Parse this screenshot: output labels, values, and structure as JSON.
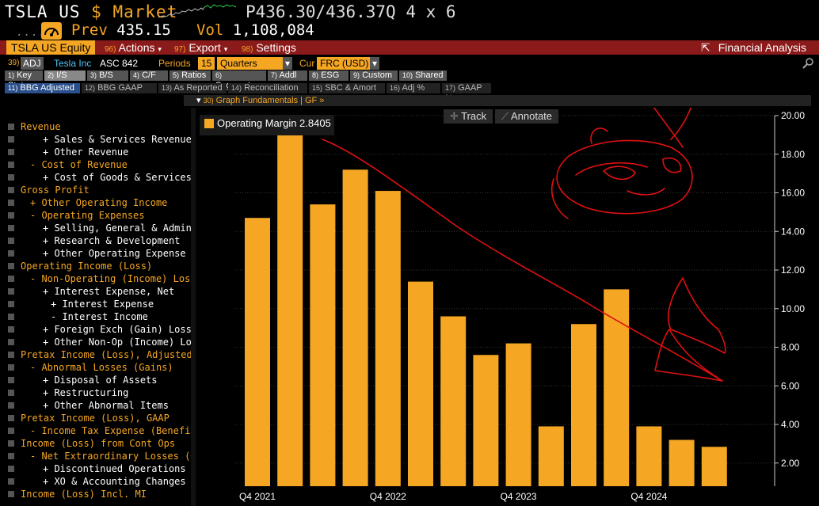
{
  "header": {
    "ticker": "TSLA US",
    "currency_symbol": "$",
    "market_label": "Market",
    "price_bid": "P436.30",
    "price_sep": "/",
    "price_ask": "436.37Q",
    "size": "4 x 6",
    "prev_label": "Prev",
    "prev_value": "435.15",
    "vol_label": "Vol",
    "vol_value": "1,108,084",
    "dots": "....."
  },
  "toolbar": {
    "security": "TSLA US Equity",
    "actions_num": "96)",
    "actions_label": "Actions",
    "export_num": "97)",
    "export_label": "Export",
    "settings_num": "98)",
    "settings_label": "Settings",
    "fa_label": "Financial Analysis"
  },
  "security_row": {
    "num": "39)",
    "adj": "ADJ",
    "company": "Tesla Inc",
    "standard": "ASC 842",
    "periods_label": "Periods",
    "periods_value": "15",
    "periods_type": "Quarters",
    "cur_label": "Cur",
    "cur_value": "FRC (USD)"
  },
  "tabs": [
    {
      "num": "1)",
      "label": "Key Stats"
    },
    {
      "num": "2)",
      "label": "I/S"
    },
    {
      "num": "3)",
      "label": "B/S"
    },
    {
      "num": "4)",
      "label": "C/F"
    },
    {
      "num": "5)",
      "label": "Ratios"
    },
    {
      "num": "6)",
      "label": "Segments"
    },
    {
      "num": "7)",
      "label": "Addl"
    },
    {
      "num": "8)",
      "label": "ESG"
    },
    {
      "num": "9)",
      "label": "Custom"
    },
    {
      "num": "10)",
      "label": "Shared"
    }
  ],
  "subtabs": [
    {
      "num": "11)",
      "label": "BBG Adjusted"
    },
    {
      "num": "12)",
      "label": "BBG GAAP"
    },
    {
      "num": "13)",
      "label": "As Reported"
    },
    {
      "num": "14)",
      "label": "Reconciliation"
    },
    {
      "num": "15)",
      "label": "SBC & Amort"
    },
    {
      "num": "16)",
      "label": "Adj %"
    },
    {
      "num": "17)",
      "label": "GAAP %"
    }
  ],
  "graph_bar": {
    "num": "30)",
    "label": "Graph Fundamentals | GF »"
  },
  "sidebar": [
    {
      "label": "Revenue",
      "color": "o",
      "indent": 0
    },
    {
      "label": "+ Sales & Services Revenue",
      "color": "w",
      "indent": 2
    },
    {
      "label": "+ Other Revenue",
      "color": "w",
      "indent": 2
    },
    {
      "label": "- Cost of Revenue",
      "color": "o",
      "indent": 1
    },
    {
      "label": "+ Cost of Goods & Services",
      "color": "w",
      "indent": 2
    },
    {
      "label": "Gross Profit",
      "color": "o",
      "indent": 0
    },
    {
      "label": "+ Other Operating Income",
      "color": "o",
      "indent": 1
    },
    {
      "label": "- Operating Expenses",
      "color": "o",
      "indent": 1
    },
    {
      "label": "+ Selling, General & Admin",
      "color": "w",
      "indent": 2
    },
    {
      "label": "+ Research & Development",
      "color": "w",
      "indent": 2
    },
    {
      "label": "+ Other Operating Expense",
      "color": "w",
      "indent": 2
    },
    {
      "label": "Operating Income (Loss)",
      "color": "o",
      "indent": 0
    },
    {
      "label": "- Non-Operating (Income) Loss",
      "color": "o",
      "indent": 1
    },
    {
      "label": "+ Interest Expense, Net",
      "color": "w",
      "indent": 2
    },
    {
      "label": "+ Interest Expense",
      "color": "w",
      "indent": 3
    },
    {
      "label": "- Interest Income",
      "color": "w",
      "indent": 3
    },
    {
      "label": "+ Foreign Exch (Gain) Loss",
      "color": "w",
      "indent": 2
    },
    {
      "label": "+ Other Non-Op (Income) Loss",
      "color": "w",
      "indent": 2
    },
    {
      "label": "Pretax Income (Loss), Adjusted",
      "color": "o",
      "indent": 0
    },
    {
      "label": "- Abnormal Losses (Gains)",
      "color": "o",
      "indent": 1
    },
    {
      "label": "+ Disposal of Assets",
      "color": "w",
      "indent": 2
    },
    {
      "label": "+ Restructuring",
      "color": "w",
      "indent": 2
    },
    {
      "label": "+ Other Abnormal Items",
      "color": "w",
      "indent": 2
    },
    {
      "label": "Pretax Income (Loss), GAAP",
      "color": "o",
      "indent": 0
    },
    {
      "label": "- Income Tax Expense (Benefit)",
      "color": "o",
      "indent": 1
    },
    {
      "label": "Income (Loss) from Cont Ops",
      "color": "o",
      "indent": 0
    },
    {
      "label": "- Net Extraordinary Losses (Gains)",
      "color": "o",
      "indent": 1
    },
    {
      "label": "+ Discontinued Operations",
      "color": "w",
      "indent": 2
    },
    {
      "label": "+ XO & Accounting Changes",
      "color": "w",
      "indent": 2
    },
    {
      "label": "Income (Loss) Incl. MI",
      "color": "o",
      "indent": 0
    }
  ],
  "chart_controls": {
    "track": "Track",
    "annotate": "Annotate"
  },
  "colors": {
    "accent": "#f5a623",
    "toolbar": "#8b1a1a",
    "annotation": "#e01010"
  },
  "chart_data": {
    "type": "bar",
    "series": [
      {
        "name": "Operating Margin 2.8405",
        "values": [
          14.7,
          19.2,
          15.4,
          17.2,
          16.1,
          11.4,
          9.6,
          7.6,
          8.2,
          3.9,
          9.2,
          11.0,
          3.9,
          3.2,
          2.84
        ]
      }
    ],
    "x_tick_labels": [
      {
        "index": 0,
        "label": "Q4 2021"
      },
      {
        "index": 4,
        "label": "Q4 2022"
      },
      {
        "index": 8,
        "label": "Q4 2023"
      },
      {
        "index": 12,
        "label": "Q4 2024"
      }
    ],
    "yticks": [
      "2.00",
      "4.00",
      "6.00",
      "8.00",
      "10.00",
      "12.00",
      "14.00",
      "16.00",
      "18.00",
      "20.00"
    ],
    "ylim": [
      0.8,
      20.0
    ],
    "grid": true,
    "legend": "top-left",
    "axis_position": "right"
  }
}
